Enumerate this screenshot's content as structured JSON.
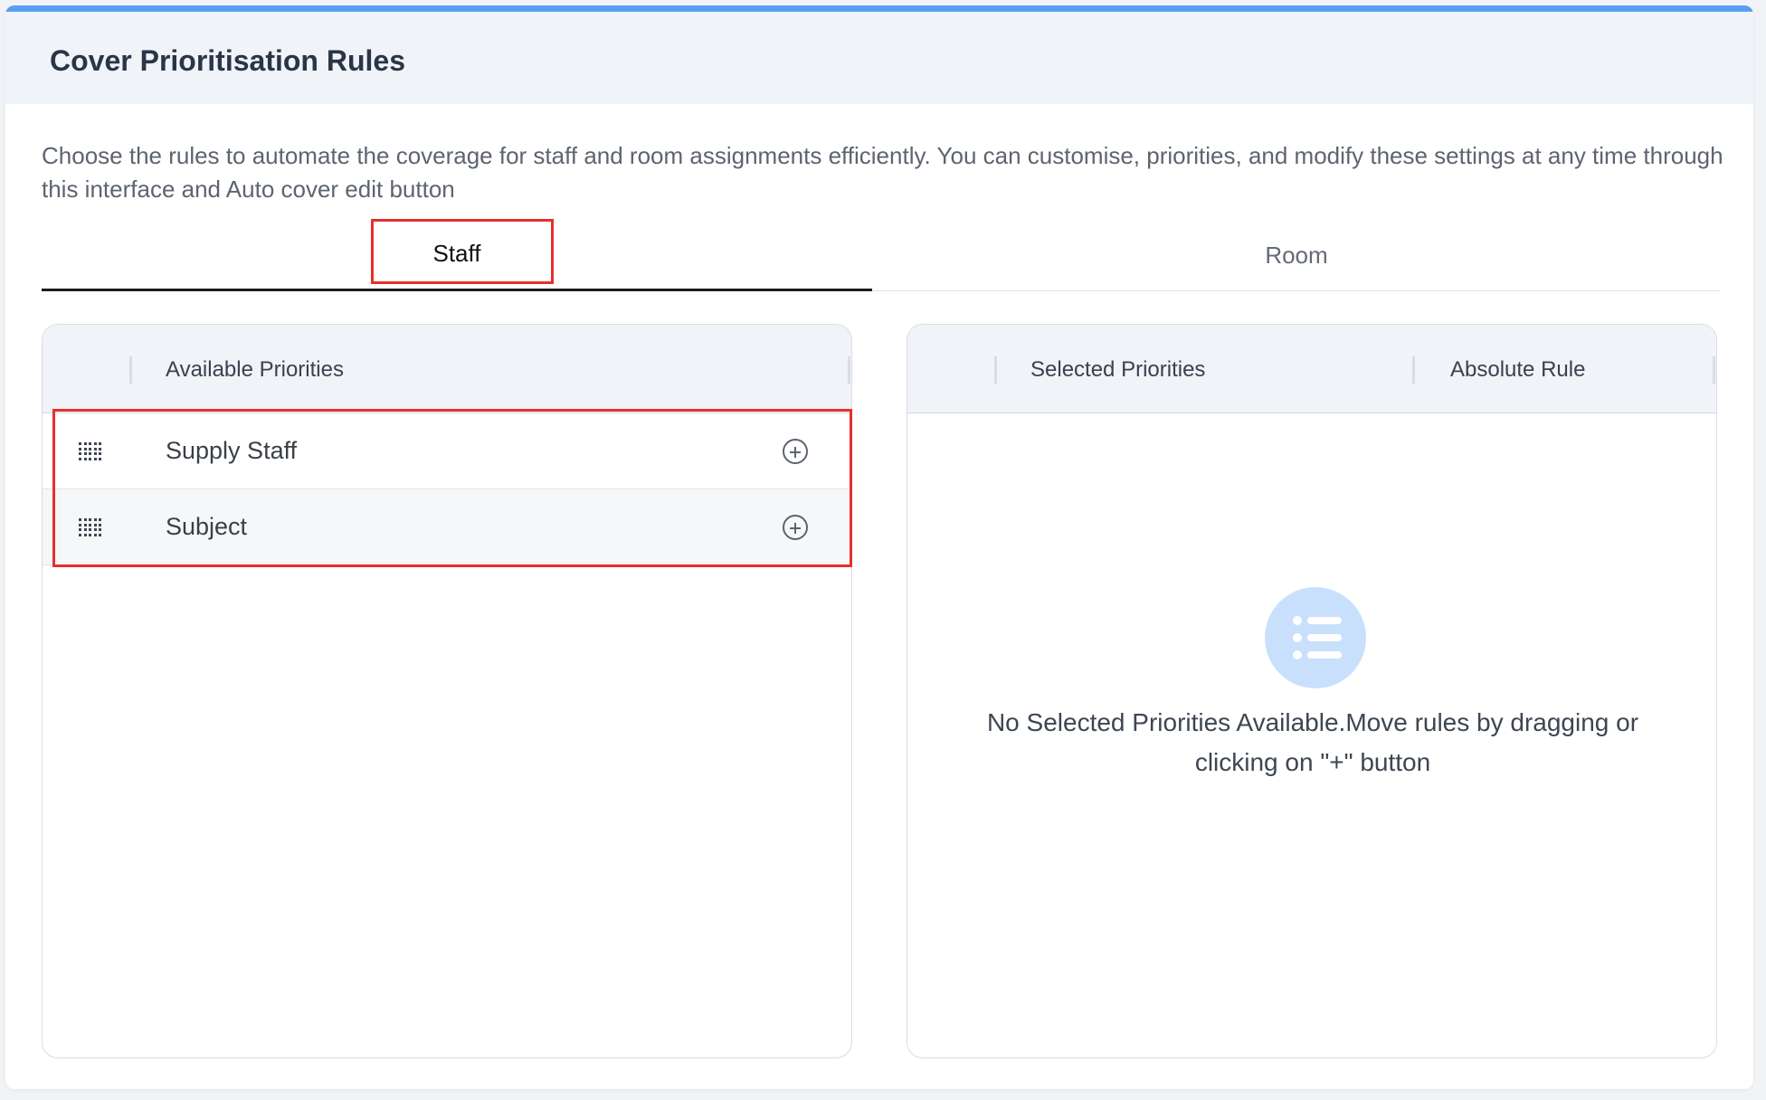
{
  "header": {
    "title": "Cover Prioritisation Rules"
  },
  "description": "Choose the rules to automate the coverage for staff and room assignments efficiently. You can customise, priorities, and modify these settings at any time through this interface and Auto cover edit button",
  "tabs": [
    {
      "label": "Staff",
      "active": true
    },
    {
      "label": "Room",
      "active": false
    }
  ],
  "available": {
    "column_label": "Available Priorities",
    "rows": [
      {
        "label": "Supply Staff"
      },
      {
        "label": "Subject"
      }
    ]
  },
  "selected": {
    "column_label": "Selected Priorities",
    "absolute_label": "Absolute Rule",
    "empty_message": "No Selected Priorities Available.Move rules by dragging or clicking on \"+\" button",
    "empty_icon": "list-icon"
  },
  "colors": {
    "accent": "#5b9ef0",
    "highlight": "#e5312a",
    "empty_icon_bg": "#c9e0fc"
  }
}
